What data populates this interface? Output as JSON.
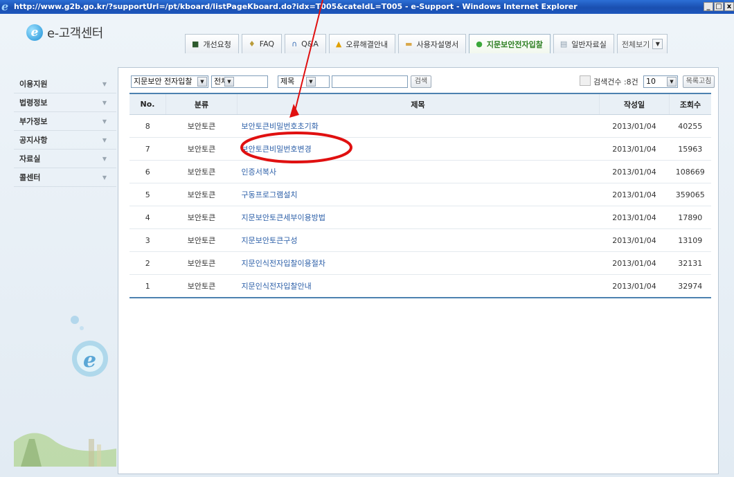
{
  "window": {
    "title": "http://www.g2b.go.kr/?supportUrl=/pt/kboard/listPageKboard.do?idx=T005&cateIdL=T005 - e-Support - Windows Internet Explorer",
    "min": "_",
    "max": "□",
    "close": "x"
  },
  "logo": {
    "text": "e-고객센터"
  },
  "tabs": [
    {
      "label": "개선요청",
      "icon": "board-icon"
    },
    {
      "label": "FAQ",
      "icon": "bulb-icon"
    },
    {
      "label": "Q&A",
      "icon": "headset-icon"
    },
    {
      "label": "오류해결안내",
      "icon": "warning-icon"
    },
    {
      "label": "사용자설명서",
      "icon": "folder-icon"
    },
    {
      "label": "지문보안전자입찰",
      "icon": "green-orb-icon",
      "active": true
    },
    {
      "label": "일반자료실",
      "icon": "database-icon"
    },
    {
      "label": "전체보기",
      "icon": "dropdown-icon"
    }
  ],
  "sidebar": {
    "items": [
      {
        "label": "이용지원"
      },
      {
        "label": "법령정보"
      },
      {
        "label": "부가정보"
      },
      {
        "label": "공지사항"
      },
      {
        "label": "자료실"
      },
      {
        "label": "콜센터"
      }
    ]
  },
  "filters": {
    "category": "지문보안 전자입찰",
    "scope": "전체",
    "field": "제목",
    "query": "",
    "search_button": "검색",
    "count_label": "검색건수 :8건",
    "page_size": "10",
    "list_button": "목록고침"
  },
  "table": {
    "headers": {
      "no": "No.",
      "category": "분류",
      "title": "제목",
      "date": "작성일",
      "views": "조회수"
    },
    "rows": [
      {
        "no": "8",
        "category": "보안토큰",
        "title": "보안토큰비밀번호초기화",
        "date": "2013/01/04",
        "views": "40255"
      },
      {
        "no": "7",
        "category": "보안토큰",
        "title": "보안토큰비밀번호변경",
        "date": "2013/01/04",
        "views": "15963"
      },
      {
        "no": "6",
        "category": "보안토큰",
        "title": "인증서복사",
        "date": "2013/01/04",
        "views": "108669"
      },
      {
        "no": "5",
        "category": "보안토큰",
        "title": "구동프로그램설치",
        "date": "2013/01/04",
        "views": "359065"
      },
      {
        "no": "4",
        "category": "보안토큰",
        "title": "지문보안토큰세부이용방법",
        "date": "2013/01/04",
        "views": "17890"
      },
      {
        "no": "3",
        "category": "보안토큰",
        "title": "지문보안토큰구성",
        "date": "2013/01/04",
        "views": "13109"
      },
      {
        "no": "2",
        "category": "보안토큰",
        "title": "지문인식전자입찰이용절차",
        "date": "2013/01/04",
        "views": "32131"
      },
      {
        "no": "1",
        "category": "보안토큰",
        "title": "지문인식전자입찰안내",
        "date": "2013/01/04",
        "views": "32974"
      }
    ]
  },
  "colors": {
    "accent_blue": "#4c81b0",
    "link": "#2c5fa8",
    "annotation_red": "#e01010",
    "active_tab": "#2a7d1f"
  }
}
